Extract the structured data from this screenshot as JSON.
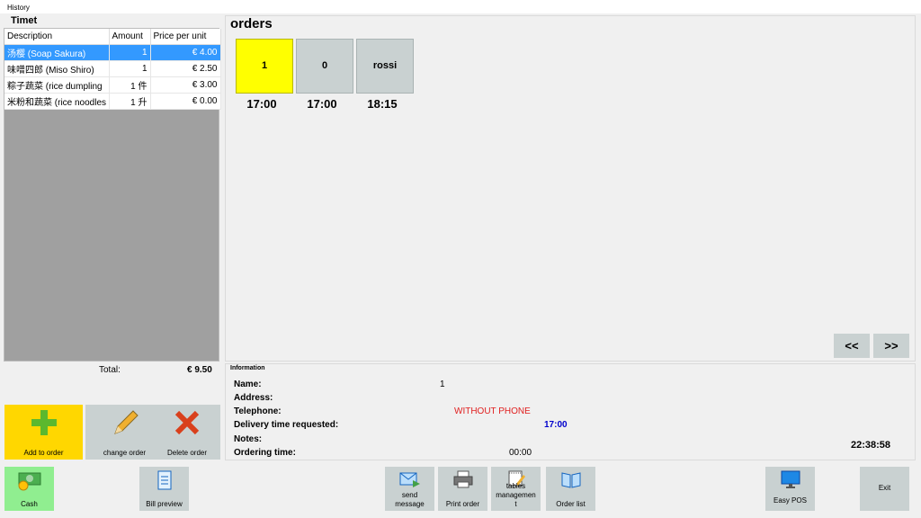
{
  "window": {
    "title": "History"
  },
  "left": {
    "section_title": "Timet",
    "columns": [
      "Description",
      "Amount",
      "Price per unit"
    ],
    "rows": [
      {
        "description": "汤樱 (Soap Sakura)",
        "amount": "1",
        "price": "€ 4.00",
        "selected": true
      },
      {
        "description": "味噌四郎 (Miso Shiro)",
        "amount": "1",
        "price": "€ 2.50",
        "selected": false
      },
      {
        "description": "粽子蔬菜 (rice dumpling",
        "amount": "1 件",
        "price": "€ 3.00",
        "selected": false
      },
      {
        "description": "米粉和蔬菜 (rice noodles",
        "amount": "1 升",
        "price": "€ 0.00",
        "selected": false
      }
    ],
    "total_label": "Total:",
    "total_value": "€ 9.50",
    "buttons": {
      "add": "Add to order",
      "change": "change order",
      "delete": "Delete order"
    }
  },
  "orders": {
    "title": "orders",
    "tiles": [
      {
        "label": "1",
        "time": "17:00",
        "color": "#ffff00"
      },
      {
        "label": "0",
        "time": "17:00",
        "color": "#c9d1d1"
      },
      {
        "label": "rossi",
        "time": "18:15",
        "color": "#c9d1d1"
      }
    ],
    "prev": "<<",
    "next": ">>"
  },
  "information": {
    "title": "Information",
    "name_label": "Name:",
    "name_value": "1",
    "address_label": "Address:",
    "telephone_label": "Telephone:",
    "telephone_value": "WITHOUT PHONE",
    "delivery_label": "Delivery time requested:",
    "delivery_value": "17:00",
    "notes_label": "Notes:",
    "ordering_label": "Ordering time:",
    "ordering_value": "00:00",
    "clock": "22:38:58"
  },
  "toolbar": {
    "cash": "Cash",
    "bill_preview": "Bill preview",
    "send_message": "send message",
    "print_order": "Print order",
    "tables_management": "tables managemen t",
    "order_list": "Order list",
    "easy_pos": "Easy POS",
    "exit": "Exit"
  },
  "colors": {
    "selected_row": "#3399ff",
    "add_button": "#ffd700",
    "cash_button": "#90ee90",
    "telephone_value": "#e02020",
    "delivery_value": "#0000cc"
  }
}
